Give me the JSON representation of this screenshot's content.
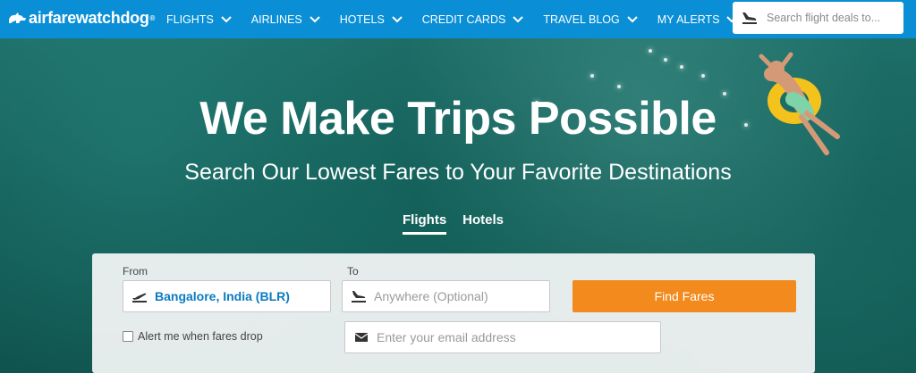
{
  "brand": {
    "logo_text": "airfarewatchdog",
    "trademark": "®"
  },
  "nav": {
    "items": [
      {
        "label": "FLIGHTS"
      },
      {
        "label": "AIRLINES"
      },
      {
        "label": "HOTELS"
      },
      {
        "label": "CREDIT CARDS"
      },
      {
        "label": "TRAVEL BLOG"
      },
      {
        "label": "MY ALERTS"
      }
    ]
  },
  "search": {
    "placeholder": "Search flight deals to..."
  },
  "hero": {
    "headline": "We Make Trips Possible",
    "subheadline": "Search Our Lowest Fares to Your Favorite Destinations"
  },
  "tabs": [
    {
      "label": "Flights",
      "active": true
    },
    {
      "label": "Hotels",
      "active": false
    }
  ],
  "form": {
    "from_label": "From",
    "from_value": "Bangalore, India (BLR)",
    "to_label": "To",
    "to_placeholder": "Anywhere (Optional)",
    "find_button": "Find Fares",
    "alert_label": "Alert me when fares drop",
    "email_placeholder": "Enter your email address"
  },
  "colors": {
    "header": "#0a8fd6",
    "accent": "#f28a1e",
    "link": "#0a7bc2"
  },
  "icons": [
    "dog-logo-icon",
    "chevron-down-icon",
    "plane-takeoff-icon",
    "plane-landing-icon",
    "envelope-icon",
    "checkbox-icon"
  ]
}
